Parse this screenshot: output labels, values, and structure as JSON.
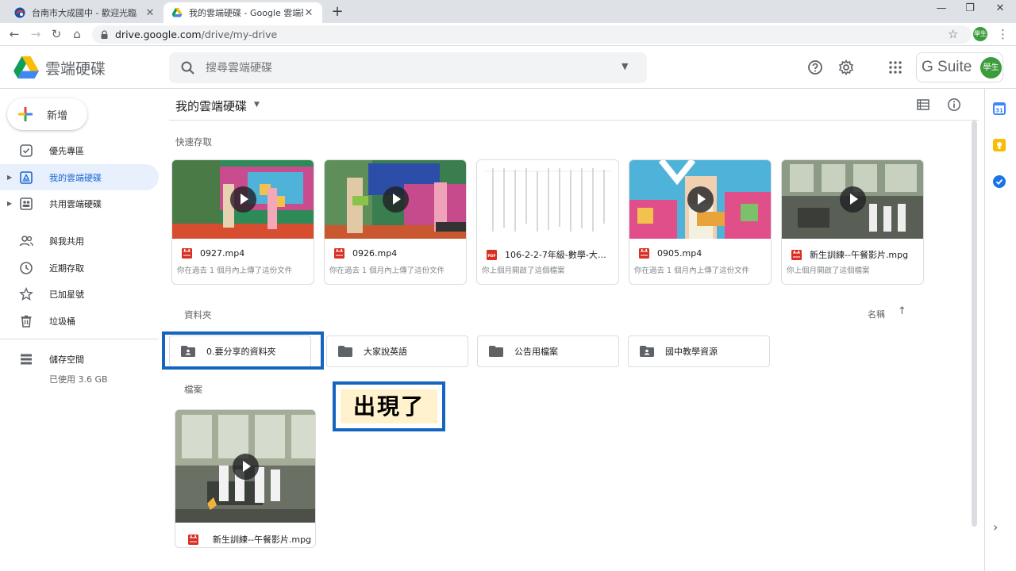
{
  "browser": {
    "tabs": [
      {
        "label": "台南市大成國中 - 歡迎光臨",
        "favicon": "school-globe-icon",
        "active": false
      },
      {
        "label": "我的雲端硬碟 - Google 雲端硬碟",
        "favicon": "google-drive-icon",
        "active": true
      }
    ],
    "new_tab_glyph": "+",
    "window_controls": {
      "minimize": "—",
      "maximize": "❐",
      "close": "✕"
    },
    "nav": {
      "back": "←",
      "forward": "→",
      "reload": "↻",
      "home": "⌂"
    },
    "url_host": "drive.google.com",
    "url_path": "/drive/my-drive",
    "bookmark_glyph": "☆",
    "profile_label": "學生",
    "menu_glyph": "⋮"
  },
  "drive_header": {
    "product_name": "雲端硬碟",
    "search_placeholder": "搜尋雲端硬碟",
    "search_dropdown": "▼",
    "gsuite_label": "G Suite",
    "avatar_label": "學生"
  },
  "sidebar": {
    "new_button": "新增",
    "items": [
      {
        "label": "優先專區",
        "icon": "priority-check-icon",
        "expandable": false,
        "active": false
      },
      {
        "label": "我的雲端硬碟",
        "icon": "my-drive-icon",
        "expandable": true,
        "active": true
      },
      {
        "label": "共用雲端硬碟",
        "icon": "shared-drives-icon",
        "expandable": true,
        "active": false
      },
      {
        "label": "與我共用",
        "icon": "shared-with-me-icon",
        "expandable": false,
        "active": false
      },
      {
        "label": "近期存取",
        "icon": "recent-clock-icon",
        "expandable": false,
        "active": false
      },
      {
        "label": "已加星號",
        "icon": "starred-icon",
        "expandable": false,
        "active": false
      },
      {
        "label": "垃圾桶",
        "icon": "trash-icon",
        "expandable": false,
        "active": false
      }
    ],
    "storage_label": "儲存空間",
    "storage_used": "已使用 3.6 GB"
  },
  "main": {
    "title": "我的雲端硬碟",
    "title_caret": "▼",
    "quick_access_label": "快速存取",
    "quick_access": [
      {
        "name": "0927.mp4",
        "type": "video",
        "reason": "你在過去 1 個月內上傳了這份文件"
      },
      {
        "name": "0926.mp4",
        "type": "video",
        "reason": "你在過去 1 個月內上傳了這份文件"
      },
      {
        "name": "106-2-2-7年級-數學-大成...",
        "type": "pdf",
        "reason": "你上個月開啟了這個檔案"
      },
      {
        "name": "0905.mp4",
        "type": "video",
        "reason": "你在過去 1 個月內上傳了這份文件"
      },
      {
        "name": "新生訓練--午餐影片.mpg",
        "type": "video",
        "reason": "你上個月開啟了這個檔案"
      }
    ],
    "folders_label": "資料夾",
    "sort_label": "名稱",
    "sort_arrow": "↑",
    "folders": [
      {
        "name": "0.要分享的資料夾",
        "shared": true
      },
      {
        "name": "大家說英語",
        "shared": false
      },
      {
        "name": "公告用檔案",
        "shared": false
      },
      {
        "name": "國中教學資源",
        "shared": true
      }
    ],
    "files_label": "檔案",
    "files": [
      {
        "name": "新生訓練--午餐影片.mpg",
        "type": "video"
      }
    ]
  },
  "annotation": {
    "callout_text": "出現了",
    "highlight_color": "#1565c0",
    "callout_bg": "#fff2cc"
  },
  "right_rail": {
    "calendar_label": "31",
    "collapse_glyph": "›"
  },
  "colors": {
    "accent_blue": "#1967d2",
    "active_bg": "#e8f0fe",
    "video_red": "#d93025",
    "avatar_green": "#3c9c3c"
  }
}
